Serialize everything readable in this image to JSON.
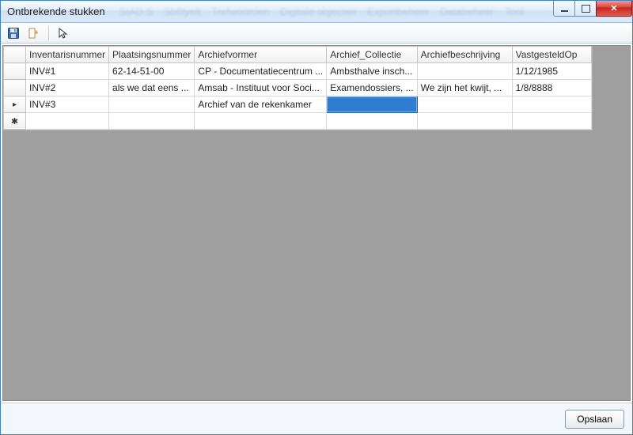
{
  "window": {
    "title": "Ontbrekende stukken"
  },
  "ghost_menu": [
    "SIAD S",
    "Sbfltyelt",
    "Trefwoorden",
    "Digitale objecten",
    "Exportbeheer",
    "Databeheer",
    "Tool"
  ],
  "toolbar": {
    "save_icon": "save-icon",
    "export_icon": "export-icon",
    "pointer_icon": "pointer-icon"
  },
  "grid": {
    "columns": [
      {
        "key": "inv",
        "label": "Inventarisnummer"
      },
      {
        "key": "pl",
        "label": "Plaatsingsnummer"
      },
      {
        "key": "av",
        "label": "Archiefvormer"
      },
      {
        "key": "ac",
        "label": "Archief_Collectie"
      },
      {
        "key": "ab",
        "label": "Archiefbeschrijving"
      },
      {
        "key": "vo",
        "label": "VastgesteldOp"
      }
    ],
    "rows": [
      {
        "marker": "",
        "inv": "INV#1",
        "pl": "62-14-51-00",
        "av": "CP - Documentatiecentrum ...",
        "ac": "Ambsthalve insch...",
        "ab": "",
        "vo": "1/12/1985"
      },
      {
        "marker": "",
        "inv": "INV#2",
        "pl": "als we dat eens ...",
        "av": "Amsab - Instituut voor Soci...",
        "ac": "Examendossiers, ...",
        "ab": "We zijn het kwijt, ...",
        "vo": "1/8/8888"
      },
      {
        "marker": "▸",
        "inv": "INV#3",
        "pl": "",
        "av": "Archief van de rekenkamer",
        "ac": "",
        "ab": "",
        "vo": "",
        "selected_col": "ac"
      },
      {
        "marker": "✱",
        "inv": "",
        "pl": "",
        "av": "",
        "ac": "",
        "ab": "",
        "vo": ""
      }
    ]
  },
  "footer": {
    "save_label": "Opslaan"
  }
}
